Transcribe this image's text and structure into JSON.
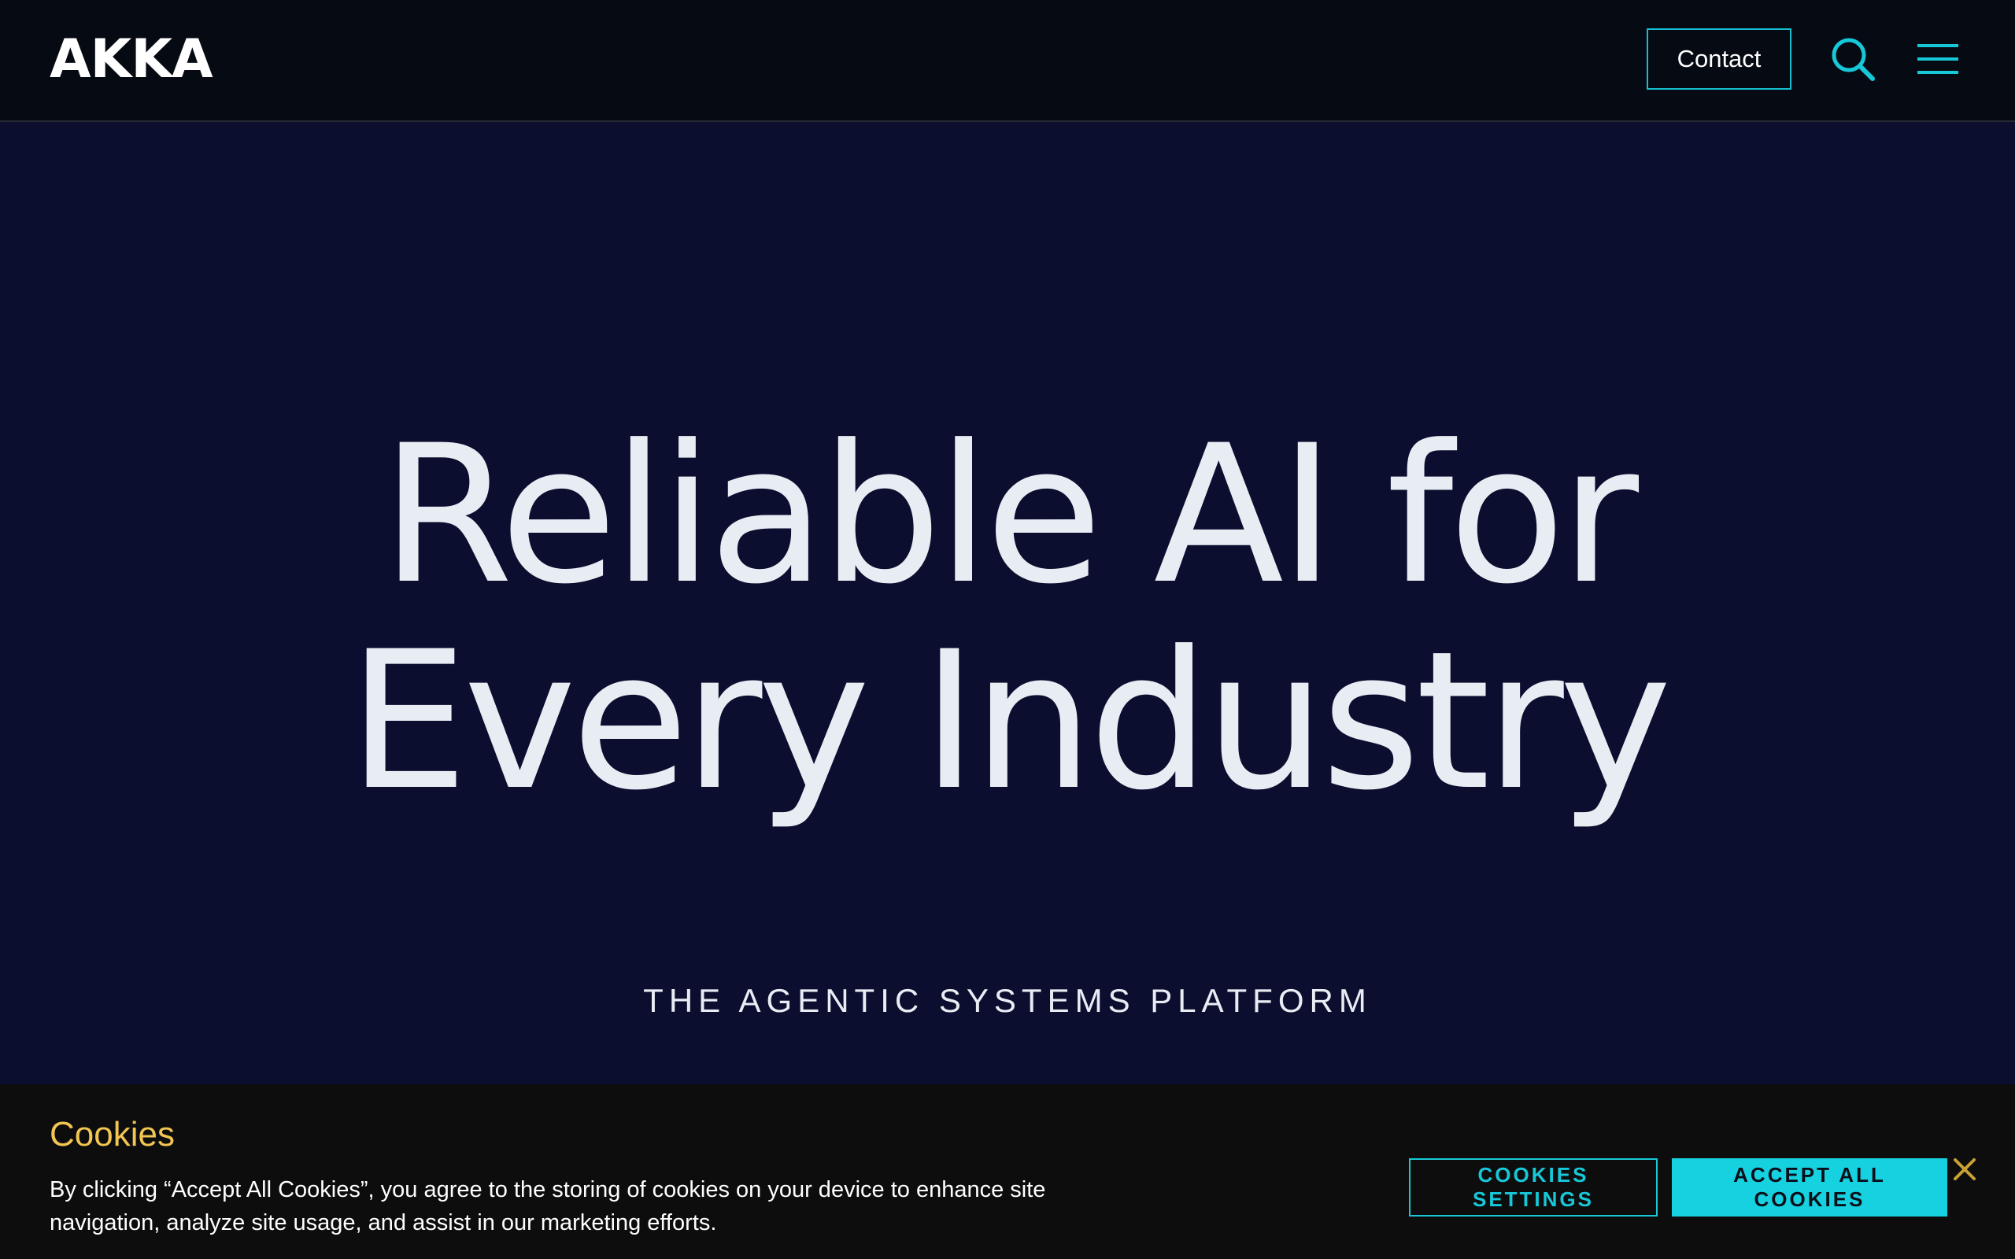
{
  "header": {
    "logo_text": "AKKA",
    "contact_label": "Contact",
    "search_icon": "search-icon",
    "menu_icon": "hamburger-menu-icon"
  },
  "hero": {
    "headline_line1": "Reliable AI for",
    "headline_line2": "Every Industry",
    "subheading": "THE AGENTIC SYSTEMS PLATFORM"
  },
  "cookie_banner": {
    "title": "Cookies",
    "description": "By clicking “Accept All Cookies”, you agree to the storing of cookies on your device to enhance site navigation, analyze site usage, and assist in our marketing efforts.",
    "settings_label": "COOKIES SETTINGS",
    "accept_label": "ACCEPT ALL COOKIES",
    "close_icon": "close-icon"
  },
  "colors": {
    "header_bg": "#060a12",
    "hero_bg": "#0b0e2f",
    "accent_cyan": "#16d2e0",
    "cookie_title": "#f2c552",
    "close_icon_gold": "#c9a233"
  }
}
